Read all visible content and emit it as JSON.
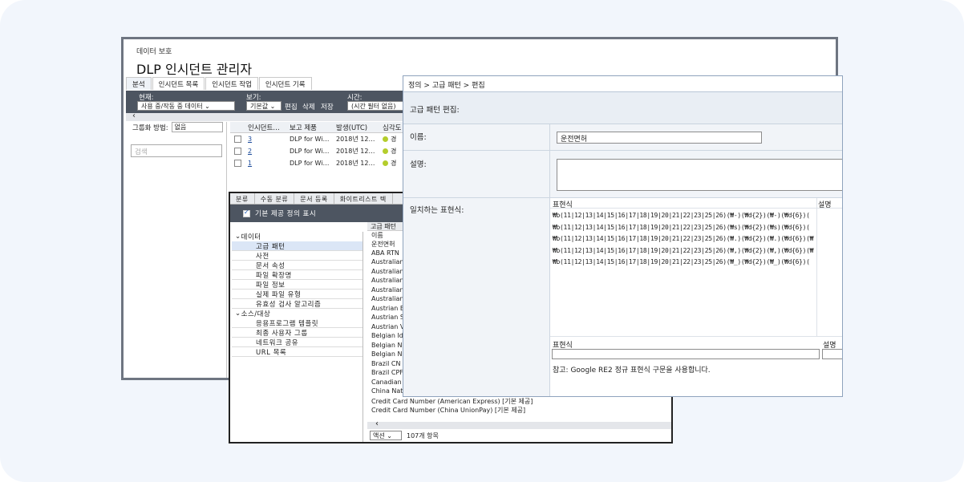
{
  "incident_window": {
    "app_name": "데이터 보호",
    "title": "DLP 인시던트 관리자",
    "tabs": [
      "분석",
      "인시던트 목록",
      "인시던트 작업",
      "인시던트 기록"
    ],
    "filters": {
      "current_label": "현재:",
      "current_value": "사용 중/작동 중 데이터",
      "view_label": "보기:",
      "view_value": "기본값",
      "edit": "편집",
      "delete": "삭제",
      "save": "저장",
      "time_label": "시간:",
      "time_value": "(시간 필터 없음)"
    },
    "group_by_label": "그룹화 방법:",
    "group_by_value": "없음",
    "search_placeholder": "검색",
    "table": {
      "columns": [
        "인시던트…",
        "보고 제품",
        "발생(UTC)",
        "심각도"
      ],
      "rows": [
        {
          "id": "3",
          "product": "DLP for Wi…",
          "date": "2018년 12…",
          "severity": "경"
        },
        {
          "id": "2",
          "product": "DLP for Wi…",
          "date": "2018년 12…",
          "severity": "경"
        },
        {
          "id": "1",
          "product": "DLP for Wi…",
          "date": "2018년 12…",
          "severity": "경"
        }
      ]
    }
  },
  "definitions_window": {
    "tabs": [
      "분류",
      "수동 분류",
      "문서 등록",
      "화이트리스트 텍"
    ],
    "show_builtin_label": "기본 제공 정의 표시",
    "tree": [
      {
        "type": "group",
        "label": "데이터"
      },
      {
        "type": "item",
        "label": "고급 패턴",
        "selected": true
      },
      {
        "type": "item",
        "label": "사전"
      },
      {
        "type": "item",
        "label": "문서 속성"
      },
      {
        "type": "item",
        "label": "파일 확장명"
      },
      {
        "type": "item",
        "label": "파일 정보"
      },
      {
        "type": "item",
        "label": "실제 파일 유형"
      },
      {
        "type": "item",
        "label": "유효성 검사 알고리즘"
      },
      {
        "type": "group",
        "label": "소스/대상"
      },
      {
        "type": "item",
        "label": "응용프로그램 템플릿"
      },
      {
        "type": "item",
        "label": "최종 사용자 그룹"
      },
      {
        "type": "item",
        "label": "네트워크 공유"
      },
      {
        "type": "item",
        "label": "URL 목록"
      }
    ],
    "list_header": "고급 패턴",
    "list_column": "이름",
    "list_items": [
      "운전면허",
      "ABA RTN",
      "Australian",
      "Australian",
      "Australian",
      "Australian",
      "Australian",
      "Austrian E",
      "Austrian S",
      "Austrian V",
      "Belgian Id",
      "Belgian N",
      "Belgian N",
      "Brazil CN",
      "Brazil CPF",
      "Canadian",
      "China Nat",
      "Credit Card Number (American Express) [기본 제공]",
      "Credit Card Number (China UnionPay) [기본 제공]"
    ],
    "action_label": "액션",
    "item_count": "107개 항목"
  },
  "pattern_editor": {
    "breadcrumb": "정의 > 고급 패턴 > 편집",
    "title": "고급 패턴 편집:",
    "name_label": "이름:",
    "name_value": "운전면허",
    "desc_label": "설명:",
    "expr_label": "일치하는 표현식:",
    "expr_col": "표현식",
    "desc_col": "설명",
    "expressions": [
      "₩b(11|12|13|14|15|16|17|18|19|20|21|22|23|25|26)(₩-)(₩d{2})(₩-)(₩d{6})(",
      "₩b(11|12|13|14|15|16|17|18|19|20|21|22|23|25|26)(₩s)(₩d{2})(₩s)(₩d{6})(",
      "₩b(11|12|13|14|15|16|17|18|19|20|21|22|23|25|26)(₩.)(₩d{2})(₩.)(₩d{6})(₩",
      "₩b(11|12|13|14|15|16|17|18|19|20|21|22|23|25|26)(₩,)(₩d{2})(₩,)(₩d{6})(₩",
      "₩b(11|12|13|14|15|16|17|18|19|20|21|22|23|25|26)(₩_)(₩d{2})(₩_)(₩d{6})("
    ],
    "new_expr_col": "표현식",
    "new_desc_col": "설명",
    "note": "참고: Google RE2 정규 표현식 구문을 사용합니다."
  }
}
